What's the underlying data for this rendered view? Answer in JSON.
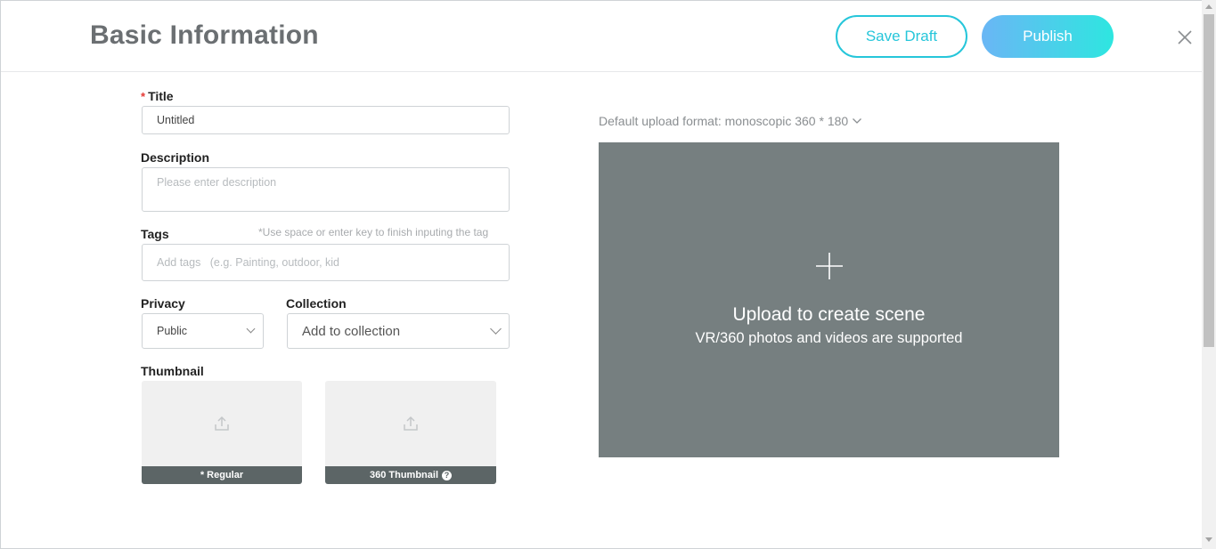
{
  "header": {
    "title": "Basic Information",
    "save_draft_label": "Save Draft",
    "publish_label": "Publish"
  },
  "form": {
    "title": {
      "label": "Title",
      "required_mark": "*",
      "value": "Untitled"
    },
    "description": {
      "label": "Description",
      "placeholder": "Please enter description"
    },
    "tags": {
      "label": "Tags",
      "hint": "*Use space or enter key to finish inputing the tag",
      "placeholder": "Add tags   (e.g. Painting, outdoor, kid"
    },
    "privacy": {
      "label": "Privacy",
      "value": "Public"
    },
    "collection": {
      "label": "Collection",
      "value": "Add to collection"
    },
    "thumbnail": {
      "label": "Thumbnail",
      "regular_label": "* Regular",
      "thumb360_label": "360 Thumbnail",
      "info_glyph": "?"
    }
  },
  "upload": {
    "format_text": "Default upload format: monoscopic 360 * 180",
    "title": "Upload to create scene",
    "subtitle": "VR/360 photos and videos are supported"
  },
  "colors": {
    "accent": "#26c6da",
    "publish_gradient_start": "#6ab6f5",
    "publish_gradient_end": "#2ee6e0",
    "upload_bg": "#767f80",
    "thumb_bar": "#5c6566",
    "required": "#e53935"
  },
  "icons": [
    "close-icon",
    "chevron-down-icon",
    "upload-icon",
    "plus-icon",
    "info-icon"
  ]
}
